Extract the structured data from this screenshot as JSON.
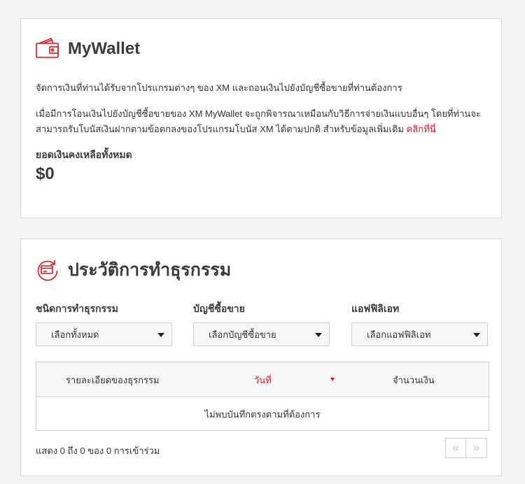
{
  "wallet": {
    "title": "MyWallet",
    "description": "จัดการเงินที่ท่านได้รับจากโปรแกรมต่างๆ ของ XM และถอนเงินไปยังบัญชีซื้อขายที่ท่านต้องการ",
    "note": "เมื่อมีการโอนเงินไปยังบัญชีซื้อขายของ XM MyWallet จะถูกพิจารณาเหมือนกับวิธีการจ่ายเงินแบบอื่นๆ โดยที่ท่านจะสามารถรับโบนัสเงินฝากตามข้อตกลงของโปรแกรมโบนัส XM ได้ตามปกติ สำหรับข้อมูลเพิ่มเติม",
    "note_link": "คลิกที่นี่",
    "balance_label": "ยอดเงินคงเหลือทั้งหมด",
    "balance_value": "$0",
    "icon": "wallet-icon"
  },
  "history": {
    "title": "ประวัติการทำธุรกรรม",
    "icon": "transaction-history-icon",
    "filters": [
      {
        "label": "ชนิดการทำธุรกรรม",
        "value": "เลือกทั้งหมด"
      },
      {
        "label": "บัญชีซื้อขาย",
        "value": "เลือกบัญชีซื้อขาย"
      },
      {
        "label": "แอฟฟิลิเอท",
        "value": "เลือกแอฟฟิลิเอท"
      }
    ],
    "table": {
      "columns": [
        "รายละเอียดของธุรกรรม",
        "วันที่",
        "จำนวนเงิน"
      ],
      "empty_message": "ไม่พบบันทึกตรงตามที่ต้องการ"
    },
    "summary": "แสดง 0 ถึง 0 ของ 0 การเข้าร่วม",
    "pager": {
      "prev": "«",
      "next": "»"
    }
  },
  "colors": {
    "accent": "#d51820",
    "text": "#333333",
    "border": "#d9d9d9",
    "background": "#f4f4f4"
  }
}
